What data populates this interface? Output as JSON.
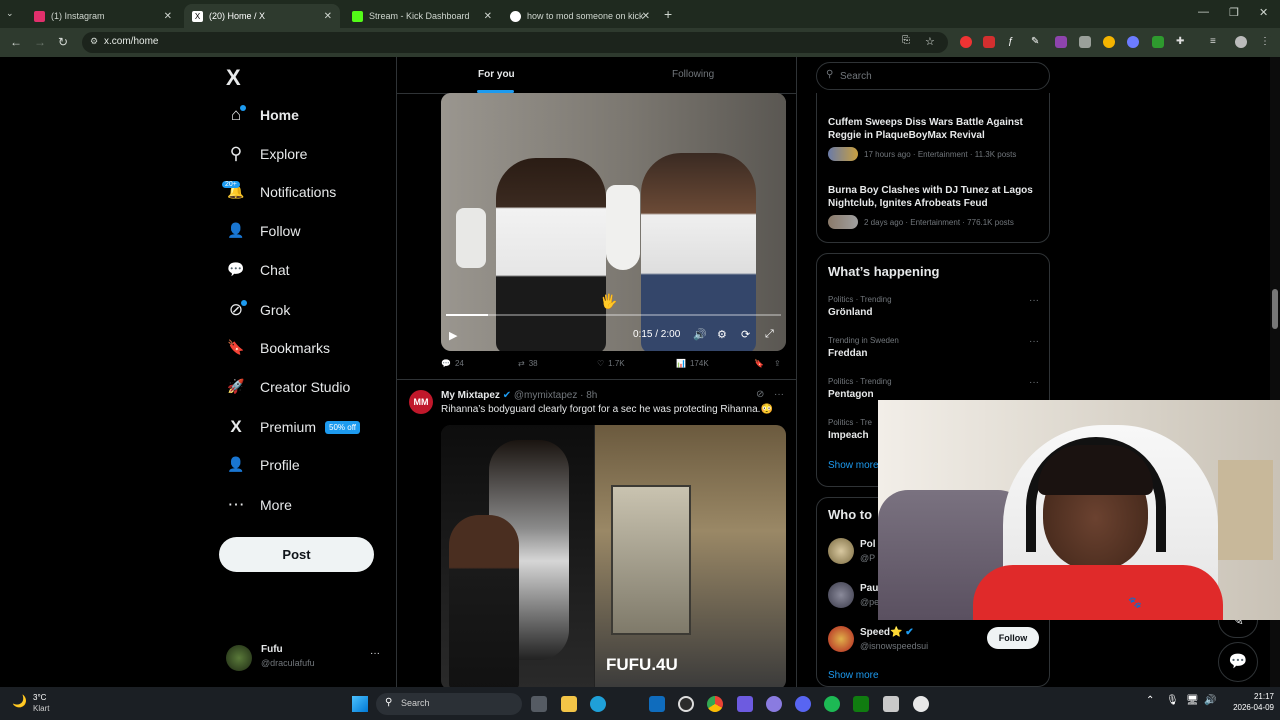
{
  "browser": {
    "tabs": [
      {
        "title": "(1) Instagram",
        "active": false,
        "favicon_color": "#e1306c"
      },
      {
        "title": "(20) Home / X",
        "active": true,
        "favicon_color": "#ffffff"
      },
      {
        "title": "Stream - Kick Dashboard",
        "active": false,
        "favicon_color": "#53fc18"
      },
      {
        "title": "how to mod someone on kick",
        "active": false,
        "favicon_color": "#4285f4"
      }
    ],
    "new_tab": "+",
    "url": "x.com/home"
  },
  "nav": {
    "logo": "X",
    "items": [
      {
        "label": "Home",
        "icon": "home-icon",
        "glyph": "⌂",
        "active": true,
        "dot": true
      },
      {
        "label": "Explore",
        "icon": "search-icon",
        "glyph": "⚲"
      },
      {
        "label": "Notifications",
        "icon": "bell-icon",
        "glyph": "🔔",
        "badge": "20+"
      },
      {
        "label": "Follow",
        "icon": "person-add-icon",
        "glyph": "👤"
      },
      {
        "label": "Chat",
        "icon": "chat-icon",
        "glyph": "💬"
      },
      {
        "label": "Grok",
        "icon": "grok-icon",
        "glyph": "⊘",
        "dot": true
      },
      {
        "label": "Bookmarks",
        "icon": "bookmark-icon",
        "glyph": "🔖"
      },
      {
        "label": "Creator Studio",
        "icon": "rocket-icon",
        "glyph": "🚀"
      },
      {
        "label": "Premium",
        "icon": "x-premium-icon",
        "glyph": "X",
        "badge": "50% off"
      },
      {
        "label": "Profile",
        "icon": "profile-icon",
        "glyph": "👤"
      },
      {
        "label": "More",
        "icon": "more-circle-icon",
        "glyph": "⋯"
      }
    ],
    "post": "Post",
    "account": {
      "name": "Fufu",
      "handle": "@draculafufu",
      "more": "···"
    }
  },
  "feed": {
    "tabs": [
      {
        "label": "For you",
        "active": true
      },
      {
        "label": "Following",
        "active": false
      }
    ],
    "video1": {
      "time": "0:15 / 2:00",
      "progress": 0.125,
      "actions": {
        "replies": "24",
        "reposts": "38",
        "likes": "1.7K",
        "views": "174K"
      }
    },
    "post2": {
      "author": "My Mixtapez",
      "handle": "@mymixtapez",
      "time": "· 8h",
      "text": "Rihanna’s bodyguard clearly forgot for a sec he was protecting Rihanna.😳",
      "watermark": "FUFU.4U",
      "more": "···"
    }
  },
  "right": {
    "search_placeholder": "Search",
    "news": [
      {
        "title": "Cuffem Sweeps Diss Wars Battle Against Reggie in PlaqueBoyMax Revival",
        "meta": "17 hours ago · Entertainment · 11.3K posts"
      },
      {
        "title": "Burna Boy Clashes with DJ Tunez at Lagos Nightclub, Ignites Afrobeats Feud",
        "meta": "2 days ago · Entertainment · 776.1K posts"
      }
    ],
    "happening_title": "What’s happening",
    "trends": [
      {
        "context": "Politics · Trending",
        "name": "Grönland"
      },
      {
        "context": "Trending in Sweden",
        "name": "Freddan"
      },
      {
        "context": "Politics · Trending",
        "name": "Pentagon"
      },
      {
        "context": "Politics · Tre",
        "name": "Impeach"
      }
    ],
    "show_more": "Show more",
    "who_title": "Who to",
    "who": [
      {
        "name": "Pol",
        "handle": "@P"
      },
      {
        "name": "Pau",
        "handle": "@pe"
      },
      {
        "name": "Speed⭐",
        "handle": "@isnowspeedsui",
        "follow": "Follow"
      }
    ],
    "who_show_more": "Show more"
  },
  "taskbar": {
    "weather_temp": "3°C",
    "weather_desc": "Klart",
    "search": "Search",
    "time": "21:17",
    "date": "2026-04-09"
  }
}
